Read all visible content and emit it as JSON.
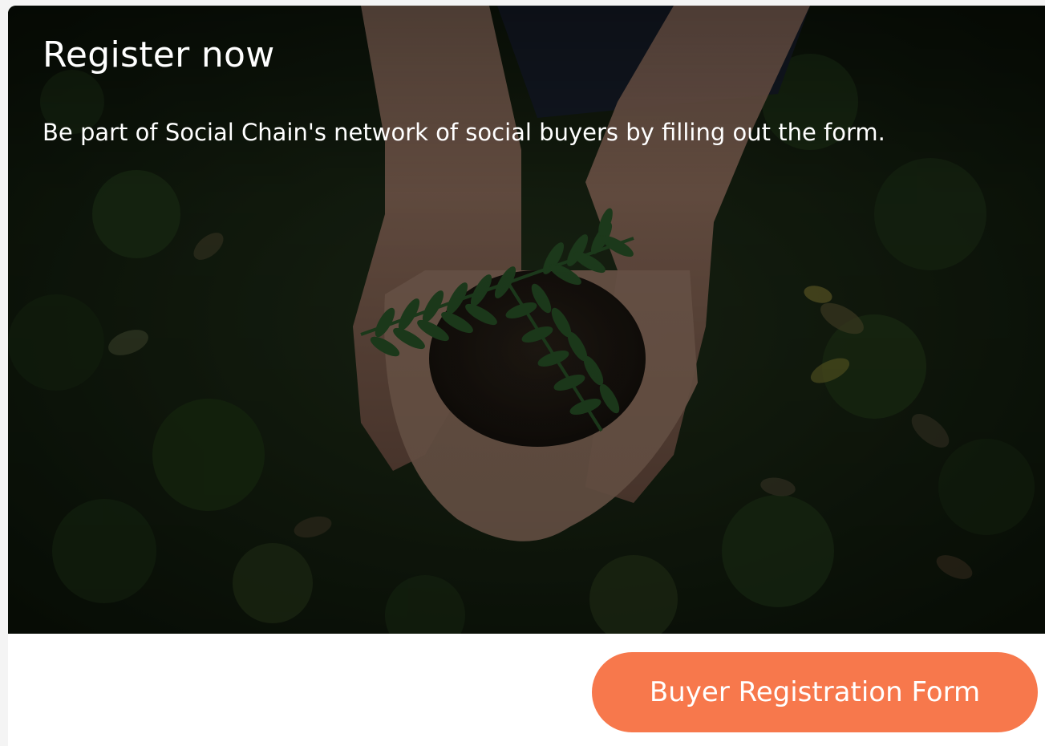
{
  "hero": {
    "title": "Register now",
    "description": "Be part of Social Chain's network of social buyers by filling out the form.",
    "image": "hands-holding-seedling-photo"
  },
  "cta": {
    "label": "Buyer Registration Form"
  },
  "colors": {
    "accent": "#f7784c",
    "text_on_image": "#ffffff",
    "footer_bg": "#ffffff"
  }
}
